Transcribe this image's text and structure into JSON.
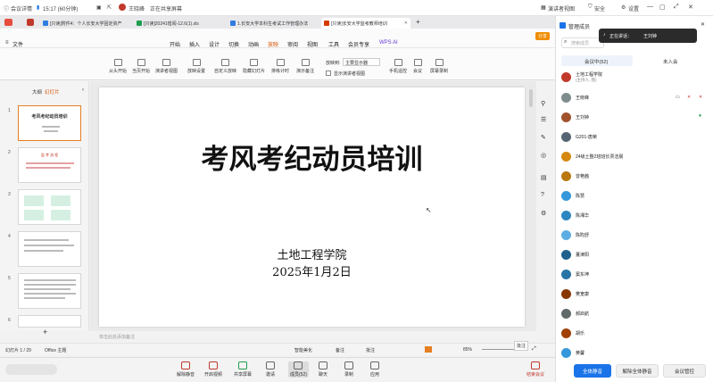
{
  "topbar": {
    "meeting_details": "会议详情",
    "timer": "15:17 (60分钟)",
    "speaker_name": "王晓峰",
    "sharing_status": "正在共享屏幕",
    "speaker_view": "演讲者视图",
    "security": "安全",
    "settings": "设置"
  },
  "tabs": [
    {
      "label": "[只读]附件4：个人长安大学固定资产",
      "color": "#2f7de1"
    },
    {
      "label": "[只读]20241借阅-12.6(1).xls",
      "color": "#1e9e4f"
    },
    {
      "label": "1.长安大学本科生考试工作管理办法",
      "color": "#2f7de1"
    },
    {
      "label": "[只读]长安大学监考教师培训",
      "color": "#d83b01"
    }
  ],
  "menu": {
    "file": "文件",
    "items": [
      "开始",
      "插入",
      "设计",
      "切换",
      "动画",
      "放映",
      "审阅",
      "视图",
      "工具",
      "会员专享"
    ],
    "active": "放映",
    "wps_ai": "WPS AI",
    "share": "分享"
  },
  "ribbon": {
    "from_start": "从头开始",
    "from_current": "当页开始",
    "presenter_view": "演讲者视图",
    "show_setup": "放映设置",
    "custom_show": "自定义放映",
    "hide_slide": "隐藏幻灯片",
    "rehearse": "排练计时",
    "record": "演示备注",
    "display_label": "放映到:",
    "display_value": "主要显示器",
    "show_presenter": "显示演讲者视图",
    "phone_remote": "手机遥控",
    "meeting": "会议",
    "screen_record": "屏幕录制"
  },
  "leftpanel": {
    "tab_outline": "大纲",
    "tab_slides": "幻灯片",
    "slide_numbers": [
      "1",
      "2",
      "3",
      "4",
      "5",
      "6"
    ],
    "thumb1_title": "考风考纪动员培训",
    "thumb2_title": "监 考 流 程"
  },
  "slide": {
    "title": "考风考纪动员培训",
    "org": "土地工程学院",
    "date": "2025年1月2日"
  },
  "status": {
    "notes_placeholder": "单击此处添加备注",
    "slide_counter": "幻灯片 1 / 29",
    "theme": "Office 主题",
    "beautify": "智能美化",
    "notes": "备注",
    "comment": "批注",
    "zoom": "85%"
  },
  "bottombar": {
    "buttons": [
      "解除静音",
      "开启视频",
      "共享屏幕",
      "邀请",
      "成员(52)",
      "聊天",
      "录制",
      "应用"
    ],
    "leave": "结束会议"
  },
  "rightpanel": {
    "title": "管理成员",
    "search_placeholder": "搜索成员",
    "speaking_label": "正在讲话：",
    "speaking_name": "王刘钟",
    "tab_in_meeting": "会议中(52)",
    "tab_not_joined": "未入会",
    "members": [
      {
        "name": "土地工程学院",
        "sub": "(主持人, 我)",
        "color": "#c0392b"
      },
      {
        "name": "王晓峰",
        "sub": "",
        "color": "#7f8c8d"
      },
      {
        "name": "王刘钟",
        "sub": "",
        "color": "#a0522d"
      },
      {
        "name": "G201-唐荣",
        "sub": "",
        "color": "#566573"
      },
      {
        "name": "24级土整2班班长贾洁晨",
        "sub": "",
        "color": "#d68910"
      },
      {
        "name": "曾艳茜",
        "sub": "",
        "color": "#b9770e"
      },
      {
        "name": "陈慧",
        "sub": "",
        "color": "#3498db"
      },
      {
        "name": "陈湘华",
        "sub": "",
        "color": "#2e86c1"
      },
      {
        "name": "陈昀舒",
        "sub": "",
        "color": "#5dade2"
      },
      {
        "name": "董津阳",
        "sub": "",
        "color": "#1f618d"
      },
      {
        "name": "窦东坤",
        "sub": "",
        "color": "#2874a6"
      },
      {
        "name": "樊宽康",
        "sub": "",
        "color": "#873600"
      },
      {
        "name": "郝启航",
        "sub": "",
        "color": "#616a6b"
      },
      {
        "name": "胡乐",
        "sub": "",
        "color": "#a04000"
      },
      {
        "name": "黄馨",
        "sub": "",
        "color": "#3498db"
      },
      {
        "name": "柯江",
        "sub": "",
        "color": "#1abc9c"
      }
    ],
    "mute_all": "全体静音",
    "unmute_all": "解除全体静音",
    "meeting_controls": "会议管控"
  }
}
